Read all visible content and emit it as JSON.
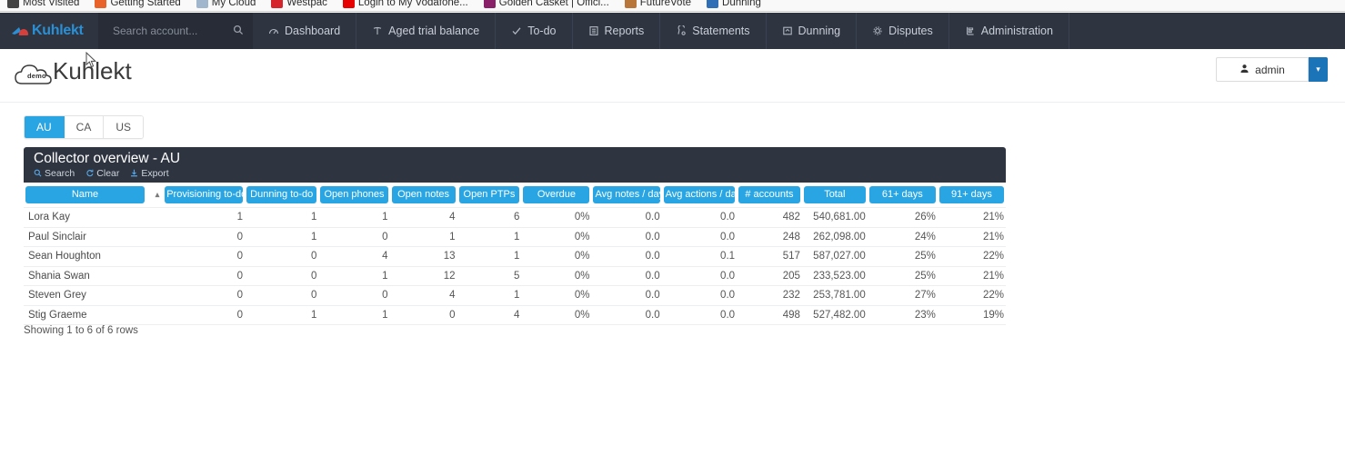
{
  "browser": {
    "bookmarks": [
      {
        "label": "Most Visited",
        "icon": "star-icon",
        "color": "#444444"
      },
      {
        "label": "Getting Started",
        "icon": "firefox-icon",
        "color": "#e8622a"
      },
      {
        "label": "My Cloud",
        "icon": "cloud-icon",
        "color": "#9fb6cc"
      },
      {
        "label": "Westpac",
        "icon": "westpac-icon",
        "color": "#d5242c"
      },
      {
        "label": "Login to My Vodafone...",
        "icon": "vodafone-icon",
        "color": "#e60000"
      },
      {
        "label": "Golden Casket | Offici...",
        "icon": "golden-casket-icon",
        "color": "#8a1f6a"
      },
      {
        "label": "FutureVote",
        "icon": "futurevote-icon",
        "color": "#b9763a"
      },
      {
        "label": "Dunning",
        "icon": "dunning-bookmark-icon",
        "color": "#2f6fb5"
      }
    ]
  },
  "navbar": {
    "brand": "Kuhlekt",
    "search": {
      "value": "",
      "placeholder": "Search account...",
      "icon": "search-icon"
    },
    "items": [
      {
        "label": "Dashboard",
        "icon": "dashboard-icon"
      },
      {
        "label": "Aged trial balance",
        "icon": "aged-trial-balance-icon"
      },
      {
        "label": "To-do",
        "icon": "check-icon"
      },
      {
        "label": "Reports",
        "icon": "reports-icon"
      },
      {
        "label": "Statements",
        "icon": "statements-icon"
      },
      {
        "label": "Dunning",
        "icon": "dunning-icon"
      },
      {
        "label": "Disputes",
        "icon": "gear-icon"
      },
      {
        "label": "Administration",
        "icon": "administration-icon"
      }
    ]
  },
  "header": {
    "logo_badge": "demo",
    "title": "Kuhlekt",
    "user": {
      "label": "admin",
      "icon": "user-icon",
      "caret": "▾"
    }
  },
  "country_tabs": {
    "items": [
      {
        "label": "AU",
        "active": true
      },
      {
        "label": "CA",
        "active": false
      },
      {
        "label": "US",
        "active": false
      }
    ]
  },
  "panel": {
    "title": "Collector overview - AU",
    "actions": [
      {
        "label": "Search",
        "icon": "search-icon"
      },
      {
        "label": "Clear",
        "icon": "clear-icon"
      },
      {
        "label": "Export",
        "icon": "export-icon"
      }
    ]
  },
  "table": {
    "sort": {
      "column": "Name",
      "direction": "asc",
      "caret": "▴"
    },
    "columns": [
      "Name",
      "Provisioning to-do",
      "Dunning to-do",
      "Open phones",
      "Open notes",
      "Open PTPs",
      "Overdue",
      "Avg notes / day",
      "Avg actions / day",
      "# accounts",
      "Total",
      "61+ days",
      "91+ days"
    ],
    "rows": [
      [
        "Lora Kay",
        "1",
        "1",
        "1",
        "4",
        "6",
        "0%",
        "0.0",
        "0.0",
        "482",
        "540,681.00",
        "26%",
        "21%"
      ],
      [
        "Paul Sinclair",
        "0",
        "1",
        "0",
        "1",
        "1",
        "0%",
        "0.0",
        "0.0",
        "248",
        "262,098.00",
        "24%",
        "21%"
      ],
      [
        "Sean Houghton",
        "0",
        "0",
        "4",
        "13",
        "1",
        "0%",
        "0.0",
        "0.1",
        "517",
        "587,027.00",
        "25%",
        "22%"
      ],
      [
        "Shania Swan",
        "0",
        "0",
        "1",
        "12",
        "5",
        "0%",
        "0.0",
        "0.0",
        "205",
        "233,523.00",
        "25%",
        "21%"
      ],
      [
        "Steven Grey",
        "0",
        "0",
        "0",
        "4",
        "1",
        "0%",
        "0.0",
        "0.0",
        "232",
        "253,781.00",
        "27%",
        "22%"
      ],
      [
        "Stig Graeme",
        "0",
        "1",
        "1",
        "0",
        "4",
        "0%",
        "0.0",
        "0.0",
        "498",
        "527,482.00",
        "23%",
        "19%"
      ]
    ],
    "footer": "Showing 1 to 6 of 6 rows"
  },
  "colors": {
    "navbar_bg": "#2e3440",
    "accent_blue": "#29a5e3",
    "button_blue": "#1b73b8",
    "panel_bg": "#2e3440"
  }
}
